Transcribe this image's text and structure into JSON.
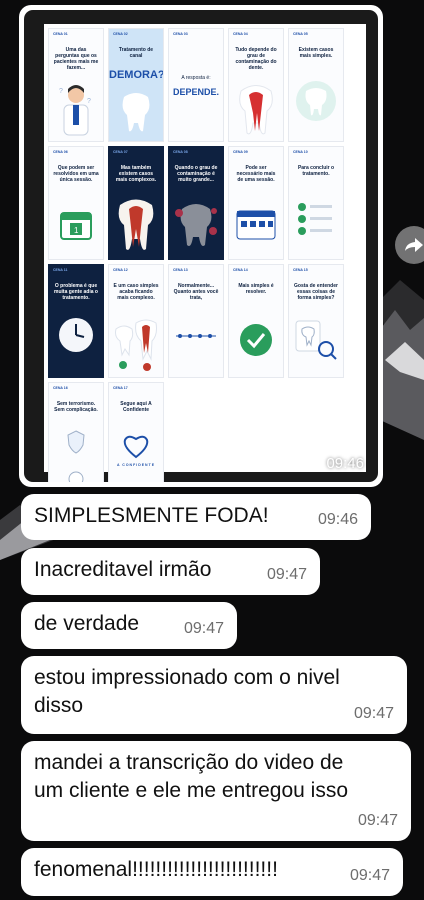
{
  "image_message": {
    "time": "09:46",
    "cards": [
      {
        "cena": "CENA 01",
        "text": "Uma das perguntas que os pacientes mais me fazem..."
      },
      {
        "cena": "CENA 02",
        "text": "Tratamento de canal",
        "big": "DEMORA?"
      },
      {
        "cena": "CENA 03",
        "text": "A resposta é:",
        "big": "DEPENDE."
      },
      {
        "cena": "CENA 04",
        "text": "Tudo depende do grau de contaminação do dente."
      },
      {
        "cena": "CENA 05",
        "text": "Existem casos mais simples."
      },
      {
        "cena": "CENA 06",
        "text": "Que podem ser resolvidos em uma única sessão."
      },
      {
        "cena": "CENA 07",
        "text": "Mas também existem casos mais complexos."
      },
      {
        "cena": "CENA 08",
        "text": "Quando o grau de contaminação é muito grande..."
      },
      {
        "cena": "CENA 09",
        "text": "Pode ser necessário mais de uma sessão."
      },
      {
        "cena": "CENA 10",
        "text": "Para concluir o tratamento."
      },
      {
        "cena": "CENA 11",
        "text": "O problema é que muita gente adia o tratamento."
      },
      {
        "cena": "CENA 12",
        "text": "E um caso simples acaba ficando mais complexo."
      },
      {
        "cena": "CENA 13",
        "text": "Normalmente... Quanto antes você trata,"
      },
      {
        "cena": "CENA 14",
        "text": "Mais simples é resolver."
      },
      {
        "cena": "CENA 15",
        "text": "Gosta de entender essas coisas de forma simples?"
      },
      {
        "cena": "CENA 16",
        "text": "Sem terrorismo. Sem complicação."
      },
      {
        "cena": "CENA 17",
        "text": "Segue aqui A Confidente",
        "brand": "A CONFIDENTE"
      }
    ]
  },
  "messages": [
    {
      "text": "SIMPLESMENTE FODA!",
      "time": "09:46"
    },
    {
      "text": "Inacreditavel irmão",
      "time": "09:47"
    },
    {
      "text": "de verdade",
      "time": "09:47"
    },
    {
      "text": "estou impressionado com o nivel\ndisso",
      "time": "09:47"
    },
    {
      "text": "mandei a transcrição do video de\num cliente e ele me entregou isso",
      "time": "09:47"
    },
    {
      "text": "fenomenal!!!!!!!!!!!!!!!!!!!!!!!!!",
      "time": "09:47"
    }
  ]
}
